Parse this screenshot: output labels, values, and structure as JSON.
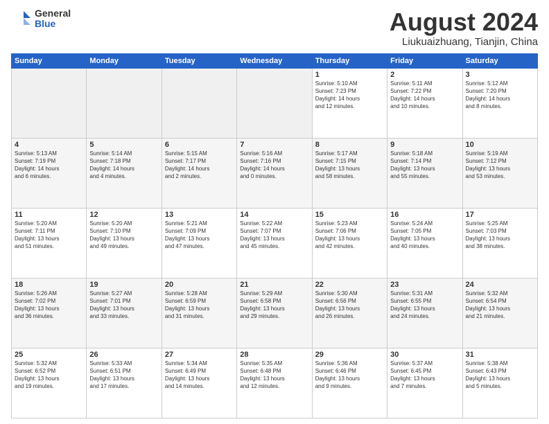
{
  "logo": {
    "general": "General",
    "blue": "Blue"
  },
  "title": "August 2024",
  "location": "Liukuaizhuang, Tianjin, China",
  "days": [
    "Sunday",
    "Monday",
    "Tuesday",
    "Wednesday",
    "Thursday",
    "Friday",
    "Saturday"
  ],
  "weeks": [
    [
      {
        "day": "",
        "info": ""
      },
      {
        "day": "",
        "info": ""
      },
      {
        "day": "",
        "info": ""
      },
      {
        "day": "",
        "info": ""
      },
      {
        "day": "1",
        "info": "Sunrise: 5:10 AM\nSunset: 7:23 PM\nDaylight: 14 hours\nand 12 minutes."
      },
      {
        "day": "2",
        "info": "Sunrise: 5:11 AM\nSunset: 7:22 PM\nDaylight: 14 hours\nand 10 minutes."
      },
      {
        "day": "3",
        "info": "Sunrise: 5:12 AM\nSunset: 7:20 PM\nDaylight: 14 hours\nand 8 minutes."
      }
    ],
    [
      {
        "day": "4",
        "info": "Sunrise: 5:13 AM\nSunset: 7:19 PM\nDaylight: 14 hours\nand 6 minutes."
      },
      {
        "day": "5",
        "info": "Sunrise: 5:14 AM\nSunset: 7:18 PM\nDaylight: 14 hours\nand 4 minutes."
      },
      {
        "day": "6",
        "info": "Sunrise: 5:15 AM\nSunset: 7:17 PM\nDaylight: 14 hours\nand 2 minutes."
      },
      {
        "day": "7",
        "info": "Sunrise: 5:16 AM\nSunset: 7:16 PM\nDaylight: 14 hours\nand 0 minutes."
      },
      {
        "day": "8",
        "info": "Sunrise: 5:17 AM\nSunset: 7:15 PM\nDaylight: 13 hours\nand 58 minutes."
      },
      {
        "day": "9",
        "info": "Sunrise: 5:18 AM\nSunset: 7:14 PM\nDaylight: 13 hours\nand 55 minutes."
      },
      {
        "day": "10",
        "info": "Sunrise: 5:19 AM\nSunset: 7:12 PM\nDaylight: 13 hours\nand 53 minutes."
      }
    ],
    [
      {
        "day": "11",
        "info": "Sunrise: 5:20 AM\nSunset: 7:11 PM\nDaylight: 13 hours\nand 51 minutes."
      },
      {
        "day": "12",
        "info": "Sunrise: 5:20 AM\nSunset: 7:10 PM\nDaylight: 13 hours\nand 49 minutes."
      },
      {
        "day": "13",
        "info": "Sunrise: 5:21 AM\nSunset: 7:09 PM\nDaylight: 13 hours\nand 47 minutes."
      },
      {
        "day": "14",
        "info": "Sunrise: 5:22 AM\nSunset: 7:07 PM\nDaylight: 13 hours\nand 45 minutes."
      },
      {
        "day": "15",
        "info": "Sunrise: 5:23 AM\nSunset: 7:06 PM\nDaylight: 13 hours\nand 42 minutes."
      },
      {
        "day": "16",
        "info": "Sunrise: 5:24 AM\nSunset: 7:05 PM\nDaylight: 13 hours\nand 40 minutes."
      },
      {
        "day": "17",
        "info": "Sunrise: 5:25 AM\nSunset: 7:03 PM\nDaylight: 13 hours\nand 38 minutes."
      }
    ],
    [
      {
        "day": "18",
        "info": "Sunrise: 5:26 AM\nSunset: 7:02 PM\nDaylight: 13 hours\nand 36 minutes."
      },
      {
        "day": "19",
        "info": "Sunrise: 5:27 AM\nSunset: 7:01 PM\nDaylight: 13 hours\nand 33 minutes."
      },
      {
        "day": "20",
        "info": "Sunrise: 5:28 AM\nSunset: 6:59 PM\nDaylight: 13 hours\nand 31 minutes."
      },
      {
        "day": "21",
        "info": "Sunrise: 5:29 AM\nSunset: 6:58 PM\nDaylight: 13 hours\nand 29 minutes."
      },
      {
        "day": "22",
        "info": "Sunrise: 5:30 AM\nSunset: 6:56 PM\nDaylight: 13 hours\nand 26 minutes."
      },
      {
        "day": "23",
        "info": "Sunrise: 5:31 AM\nSunset: 6:55 PM\nDaylight: 13 hours\nand 24 minutes."
      },
      {
        "day": "24",
        "info": "Sunrise: 5:32 AM\nSunset: 6:54 PM\nDaylight: 13 hours\nand 21 minutes."
      }
    ],
    [
      {
        "day": "25",
        "info": "Sunrise: 5:32 AM\nSunset: 6:52 PM\nDaylight: 13 hours\nand 19 minutes."
      },
      {
        "day": "26",
        "info": "Sunrise: 5:33 AM\nSunset: 6:51 PM\nDaylight: 13 hours\nand 17 minutes."
      },
      {
        "day": "27",
        "info": "Sunrise: 5:34 AM\nSunset: 6:49 PM\nDaylight: 13 hours\nand 14 minutes."
      },
      {
        "day": "28",
        "info": "Sunrise: 5:35 AM\nSunset: 6:48 PM\nDaylight: 13 hours\nand 12 minutes."
      },
      {
        "day": "29",
        "info": "Sunrise: 5:36 AM\nSunset: 6:46 PM\nDaylight: 13 hours\nand 9 minutes."
      },
      {
        "day": "30",
        "info": "Sunrise: 5:37 AM\nSunset: 6:45 PM\nDaylight: 13 hours\nand 7 minutes."
      },
      {
        "day": "31",
        "info": "Sunrise: 5:38 AM\nSunset: 6:43 PM\nDaylight: 13 hours\nand 5 minutes."
      }
    ]
  ]
}
